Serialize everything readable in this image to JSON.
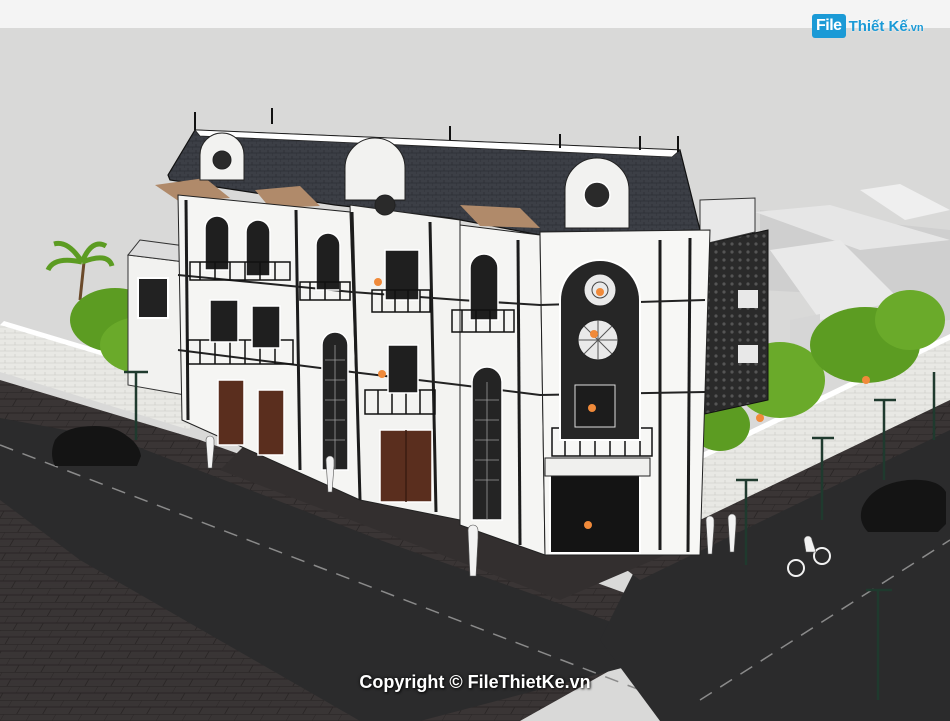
{
  "logo": {
    "box_text": "File",
    "rest_text": "Thiết Kế",
    "tld_text": ".vn"
  },
  "watermark": {
    "text": "Copyright © FileThietKe.vn"
  },
  "colors": {
    "background_gray": "#d9d9d8",
    "roof_slate": "#3c3f46",
    "facade_white": "#f5f5f3",
    "ironwork_black": "#1c1c1c",
    "pavement_dark": "#3a3535",
    "road_asphalt": "#2b2b2c",
    "tree_green": "#5c9c22",
    "brand_blue": "#1b9ad6",
    "lamp_orange": "#f08a3a"
  }
}
